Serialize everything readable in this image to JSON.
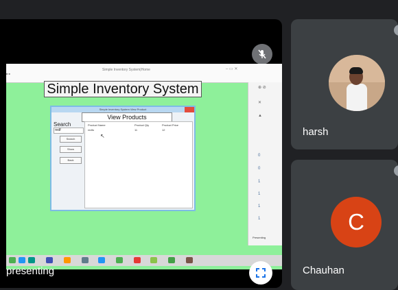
{
  "shared_screen": {
    "window_title": "Simple Inventory System|Home",
    "app_title": "Simple Inventory System",
    "dialog": {
      "window_title": "Simple Inventory System View Product",
      "heading": "View Products",
      "search_label": "Search",
      "search_value": "redf",
      "buttons": [
        "Search",
        "Show",
        "Back"
      ],
      "table_headers": [
        "Product Name",
        "Product Qty",
        "Product Price"
      ],
      "table_row": [
        "redfo",
        "11",
        "12"
      ]
    },
    "side_values": [
      "0",
      "0",
      "1",
      "1",
      "1",
      "1"
    ],
    "side_label": "Presenting"
  },
  "main_tile": {
    "presenting_label": "presenting"
  },
  "participants": [
    {
      "name": "harsh",
      "avatar": "photo"
    },
    {
      "name": "Chauhan",
      "avatar_letter": "C",
      "avatar_color": "#d84315"
    }
  ],
  "icons": [
    "mic-off-icon",
    "fullscreen-icon"
  ]
}
